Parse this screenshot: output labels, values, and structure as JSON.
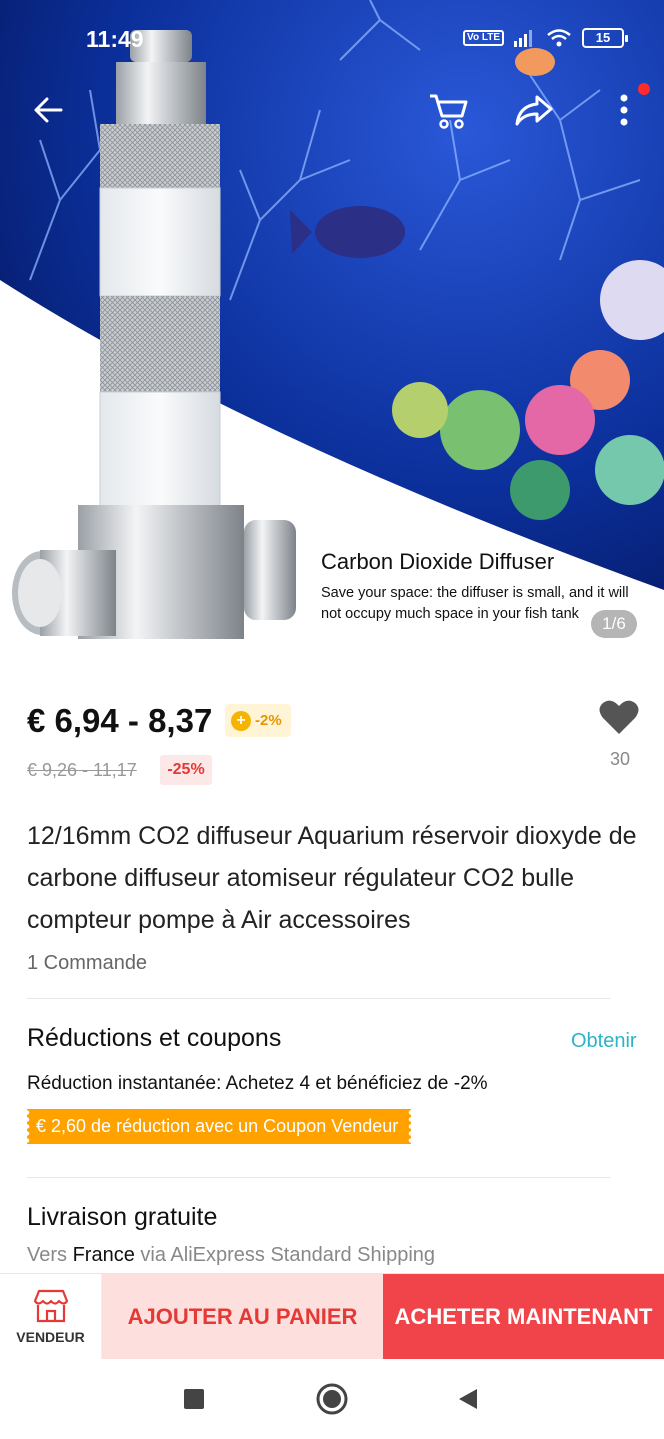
{
  "status_bar": {
    "time": "11:49",
    "volte": "Vo LTE",
    "battery": "15"
  },
  "hero": {
    "title": "Carbon Dioxide Diffuser",
    "description": "Save your space: the diffuser is small, and it will not occupy much space in your fish tank",
    "pager": "1/6"
  },
  "price": {
    "current": "€ 6,94 - 8,37",
    "promo_icon": "+",
    "promo": "-2%",
    "original": "€ 9,26 - 11,17",
    "discount": "-25%",
    "likes": "30"
  },
  "product": {
    "title": "12/16mm CO2 diffuseur Aquarium réservoir dioxyde de carbone diffuseur atomiseur régulateur CO2 bulle compteur pompe à Air accessoires",
    "orders": "1 Commande"
  },
  "coupons": {
    "title": "Réductions et coupons",
    "action": "Obtenir",
    "instant": "Réduction instantanée: Achetez 4 et bénéficiez de -2%",
    "seller_coupon": "€ 2,60 de réduction avec un Coupon Vendeur"
  },
  "shipping": {
    "title": "Livraison gratuite",
    "prefix": "Vers",
    "destination": "France",
    "method": "via AliExpress Standard Shipping"
  },
  "action_bar": {
    "seller": "VENDEUR",
    "add_to_cart": "AJOUTER AU PANIER",
    "buy_now": "ACHETER MAINTENANT"
  },
  "colors": {
    "accent_red": "#f0444a",
    "cart_bg": "#fde0de",
    "coupon_orange": "#ffa200",
    "link_teal": "#2bb3c8"
  },
  "icons": [
    "back-arrow-icon",
    "cart-icon",
    "share-icon",
    "more-icon",
    "heart-icon",
    "store-icon",
    "nav-square-icon",
    "nav-home-icon",
    "nav-back-icon"
  ]
}
